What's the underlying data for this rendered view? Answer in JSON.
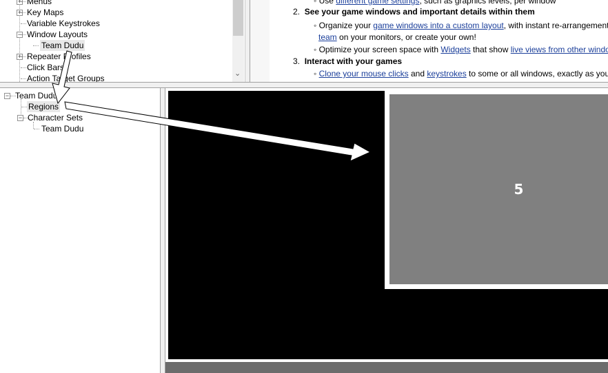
{
  "top_tree": {
    "items": [
      {
        "label": "Menus",
        "expander": "plus"
      },
      {
        "label": "Key Maps",
        "expander": "plus"
      },
      {
        "label": "Variable Keystrokes",
        "expander": "none"
      },
      {
        "label": "Window Layouts",
        "expander": "minus"
      },
      {
        "label": "Team Dudu",
        "expander": "none",
        "child": true,
        "selected": true
      },
      {
        "label": "Repeater Profiles",
        "expander": "plus"
      },
      {
        "label": "Click Bars",
        "expander": "none"
      },
      {
        "label": "Action Target Groups",
        "expander": "none"
      }
    ],
    "scroll_down_icon": "chevron-down-icon"
  },
  "help": {
    "item1_sub": {
      "prefix": "Use ",
      "link": "different game settings",
      "suffix": ", such as graphics levels, per window"
    },
    "item2": {
      "num": "2.",
      "title": "See your game windows and important details within them"
    },
    "item2_sub1": {
      "prefix": "Organize your ",
      "link": "game windows into a custom layout",
      "suffix": ", with instant re-arrangement wh",
      "link2": "team",
      "suffix2": " on your monitors, or create your own!"
    },
    "item2_sub2": {
      "prefix": "Optimize your screen space with ",
      "link": "Widgets",
      "mid": " that show ",
      "link2": "live views from other windows"
    },
    "item3": {
      "num": "3.",
      "title": "Interact with your games"
    },
    "item3_sub": {
      "link": "Clone your mouse clicks",
      "mid": " and ",
      "link2": "keystrokes",
      "suffix": " to some or all windows, exactly as you pr"
    }
  },
  "bottom_tree": {
    "root": "Team Dudu",
    "regions": "Regions",
    "character_sets": "Character Sets",
    "character_set_child": "Team Dudu"
  },
  "layout_preview": {
    "region_label": "5",
    "colors": {
      "background": "#000000",
      "region_border": "#ffffff",
      "region_fill": "#808080",
      "bottom_bar": "#6c6c6c"
    }
  }
}
